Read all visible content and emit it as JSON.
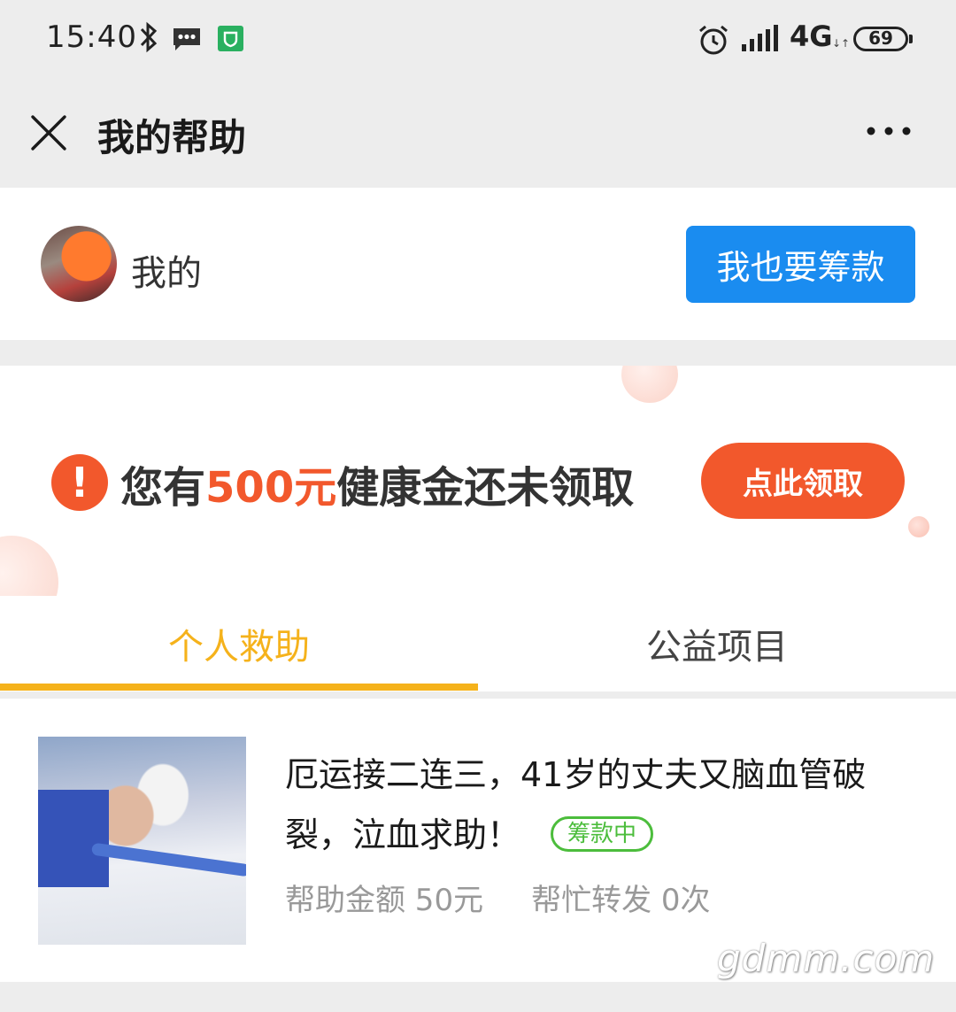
{
  "status_bar": {
    "time": "15:40",
    "network": "4G",
    "battery": "69",
    "icons": [
      "bluetooth-icon",
      "message-icon",
      "shield-icon",
      "alarm-icon",
      "signal-icon"
    ]
  },
  "title_bar": {
    "title": "我的帮助",
    "close_icon": "close-icon",
    "more_icon": "more-icon"
  },
  "user": {
    "name": "我的",
    "raise_button": "我也要筹款"
  },
  "banner": {
    "text_prefix": "您有",
    "amount": "500元",
    "text_suffix": "健康金还未领取",
    "alert_mark": "!",
    "claim_button": "点此领取",
    "accent_color": "#f2582c"
  },
  "tabs": [
    {
      "label": "个人救助",
      "active": true
    },
    {
      "label": "公益项目",
      "active": false
    }
  ],
  "items": [
    {
      "title": "厄运接二连三，41岁的丈夫又脑血管破裂，泣血求助！",
      "status": "筹款中",
      "help_amount": "帮助金额 50元",
      "shares": "帮忙转发 0次"
    }
  ],
  "watermark": "gdmm.com",
  "colors": {
    "primary_blue": "#1a8cf0",
    "tab_active": "#f5b21b",
    "badge_green": "#4cbd3c"
  }
}
